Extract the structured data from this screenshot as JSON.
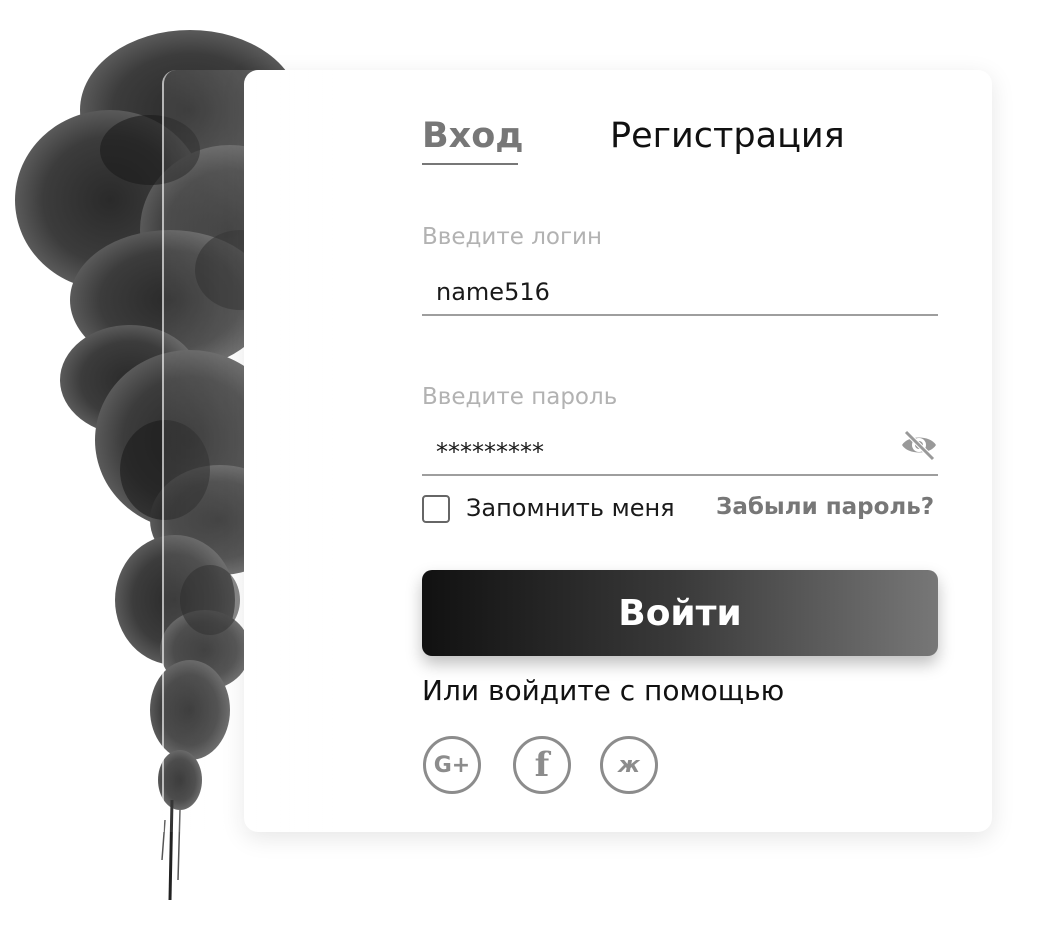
{
  "tabs": {
    "login": "Вход",
    "register": "Регистрация"
  },
  "login_field": {
    "label": "Введите логин",
    "value": "name516"
  },
  "password_field": {
    "label": "Введите пароль",
    "value": "*********",
    "toggle_icon": "eye-slash-icon"
  },
  "remember": {
    "label": "Запомнить меня",
    "checked": false
  },
  "forgot_link": "Забыли пароль?",
  "submit_button": "Войти",
  "alt_login_text": "Или войдите с помощью",
  "social": [
    {
      "icon": "google-plus-icon",
      "glyph": "G+"
    },
    {
      "icon": "facebook-icon",
      "glyph": "f"
    },
    {
      "icon": "vk-icon",
      "glyph": "ж"
    }
  ],
  "colors": {
    "accent_gray": "#777777",
    "button_gradient_start": "#111111",
    "button_gradient_end": "#777777"
  }
}
